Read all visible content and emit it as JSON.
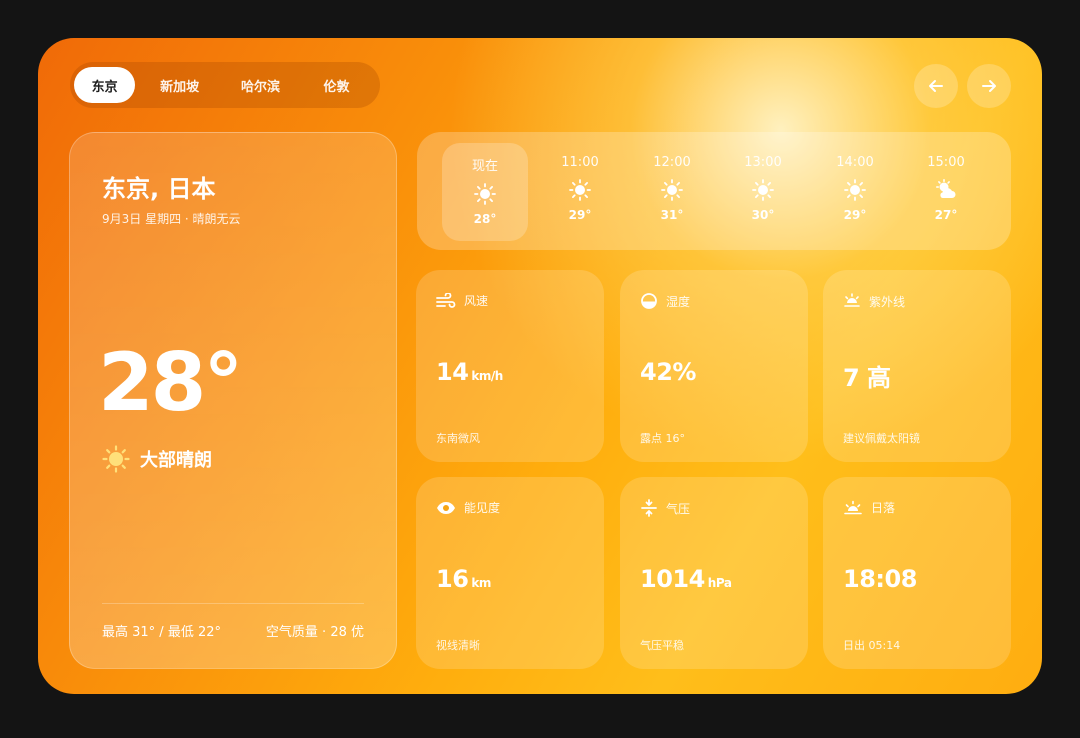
{
  "tabs": [
    "东京",
    "新加坡",
    "哈尔滨",
    "伦敦"
  ],
  "nav": {
    "prev_icon": "arrow-left-icon",
    "next_icon": "arrow-right-icon"
  },
  "main": {
    "city": "东京, 日本",
    "date": "9月3日 星期四 · 晴朗无云",
    "temperature": "28°",
    "condition": "大部晴朗",
    "condition_icon": "sun-icon",
    "hilo": "最高 31° / 最低 22°",
    "aqi": "空气质量 · 28 优"
  },
  "hourly": [
    {
      "time": "现在",
      "temp": "28°",
      "icon": "sun-icon"
    },
    {
      "time": "11:00",
      "temp": "29°",
      "icon": "sun-icon"
    },
    {
      "time": "12:00",
      "temp": "31°",
      "icon": "sun-icon"
    },
    {
      "time": "13:00",
      "temp": "30°",
      "icon": "sun-icon"
    },
    {
      "time": "14:00",
      "temp": "29°",
      "icon": "sun-icon"
    },
    {
      "time": "15:00",
      "temp": "27°",
      "icon": "partly-cloudy-icon"
    }
  ],
  "metrics": {
    "wind": {
      "label": "风速",
      "value": "14",
      "unit": "km/h",
      "sub": "东南微风",
      "icon": "wind-icon"
    },
    "humidity": {
      "label": "湿度",
      "value": "42%",
      "unit": "",
      "sub": "露点 16°",
      "icon": "humidity-icon"
    },
    "uv": {
      "label": "紫外线",
      "value": "7 高",
      "unit": "",
      "sub": "建议佩戴太阳镜",
      "icon": "uv-icon"
    },
    "visibility": {
      "label": "能见度",
      "value": "16",
      "unit": "km",
      "sub": "视线清晰",
      "icon": "eye-icon"
    },
    "pressure": {
      "label": "气压",
      "value": "1014",
      "unit": "hPa",
      "sub": "气压平稳",
      "icon": "pressure-icon"
    },
    "sunset": {
      "label": "日落",
      "value": "18:08",
      "unit": "",
      "sub": "日出 05:14",
      "icon": "sunset-icon"
    }
  }
}
